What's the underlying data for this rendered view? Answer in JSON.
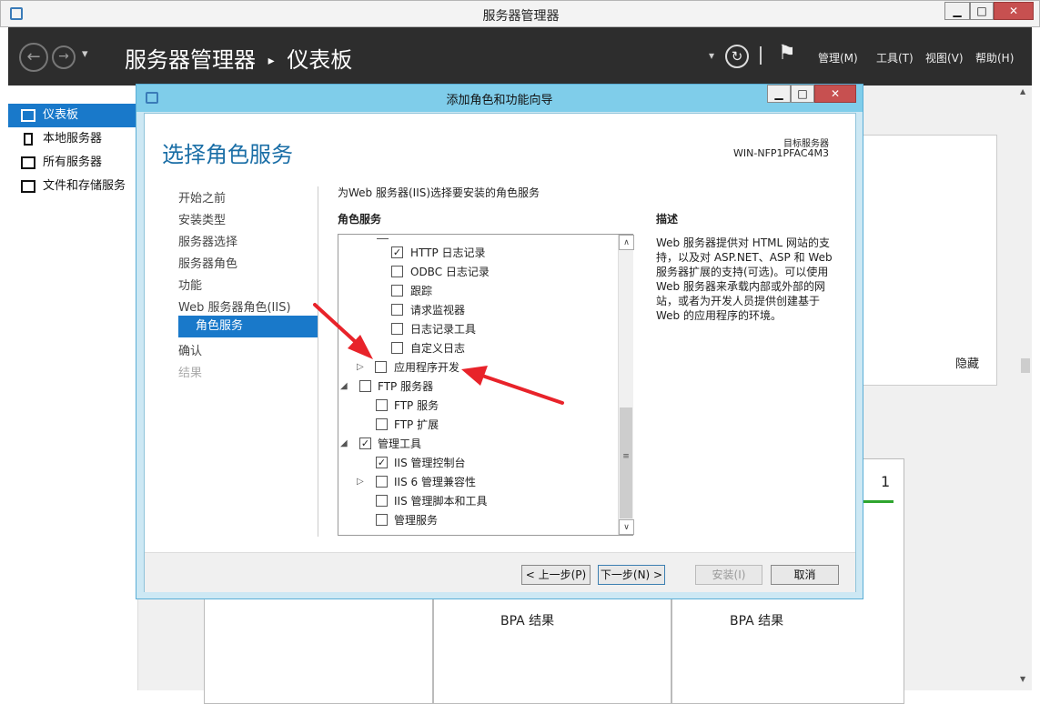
{
  "window": {
    "title": "服务器管理器",
    "minimize": "▁",
    "maximize": "□",
    "close": "✕"
  },
  "header": {
    "back": "←",
    "forward": "→",
    "dropdown": "▾",
    "breadcrumb_root": "服务器管理器",
    "breadcrumb_sep": "▸",
    "breadcrumb_page": "仪表板",
    "refresh": "↻",
    "flag": "⚑",
    "menus": {
      "manage": "管理(M)",
      "tools": "工具(T)",
      "view": "视图(V)",
      "help": "帮助(H)"
    }
  },
  "leftnav": {
    "items": [
      {
        "label": "仪表板",
        "selected": true
      },
      {
        "label": "本地服务器"
      },
      {
        "label": "所有服务器"
      },
      {
        "label": "文件和存储服务"
      }
    ]
  },
  "background": {
    "hide": "隐藏",
    "count": "1",
    "bpa1": "BPA 结果",
    "bpa2": "BPA 结果"
  },
  "dialog": {
    "title": "添加角色和功能向导",
    "heading": "选择角色服务",
    "target_label": "目标服务器",
    "target_name": "WIN-NFP1PFAC4M3",
    "steps": {
      "s1": "开始之前",
      "s2": "安装类型",
      "s3": "服务器选择",
      "s4": "服务器角色",
      "s5": "功能",
      "s6": "Web 服务器角色(IIS)",
      "s7": "角色服务",
      "s8": "确认",
      "s9": "结果"
    },
    "instruction": "为Web 服务器(IIS)选择要安装的角色服务",
    "role_services_label": "角色服务",
    "tree": {
      "i1": "HTTP 日志记录",
      "i2": "ODBC 日志记录",
      "i3": "跟踪",
      "i4": "请求监视器",
      "i5": "日志记录工具",
      "i6": "自定义日志",
      "i7": "应用程序开发",
      "i8": "FTP 服务器",
      "i9": "FTP 服务",
      "i10": "FTP 扩展",
      "i11": "管理工具",
      "i12": "IIS 管理控制台",
      "i13": "IIS 6 管理兼容性",
      "i14": "IIS 管理脚本和工具",
      "i15": "管理服务"
    },
    "check": "✓",
    "desc_label": "描述",
    "desc_text": "Web 服务器提供对 HTML 网站的支持，以及对 ASP.NET、ASP 和 Web 服务器扩展的支持(可选)。可以使用 Web 服务器来承载内部或外部的网站，或者为开发人员提供创建基于 Web 的应用程序的环境。",
    "buttons": {
      "prev": "< 上一步(P)",
      "next": "下一步(N) >",
      "install": "安装(I)",
      "cancel": "取消"
    }
  },
  "colors": {
    "accent": "#1979ca",
    "header_bg": "#2d2d2d",
    "dialog_title": "#7fcdea",
    "arrow": "#e8232a"
  }
}
